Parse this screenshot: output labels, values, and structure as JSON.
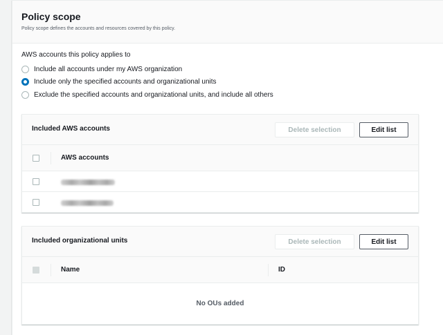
{
  "section": {
    "title": "Policy scope",
    "description": "Policy scope defines the accounts and resources covered by this policy."
  },
  "accounts_field": {
    "label": "AWS accounts this policy applies to",
    "options": [
      {
        "label": "Include all accounts under my AWS organization",
        "selected": false
      },
      {
        "label": "Include only the specified accounts and organizational units",
        "selected": true
      },
      {
        "label": "Exclude the specified accounts and organizational units, and include all others",
        "selected": false
      }
    ]
  },
  "accounts_table": {
    "title": "Included AWS accounts",
    "delete_label": "Delete selection",
    "edit_label": "Edit list",
    "column": "AWS accounts",
    "row_count": 2
  },
  "ou_table": {
    "title": "Included organizational units",
    "delete_label": "Delete selection",
    "edit_label": "Edit list",
    "columns": [
      "Name",
      "ID"
    ],
    "empty_message": "No OUs added"
  },
  "colors": {
    "accent": "#0073bb",
    "text": "#16191f",
    "muted": "#545b64",
    "disabled": "#aab7b8"
  }
}
